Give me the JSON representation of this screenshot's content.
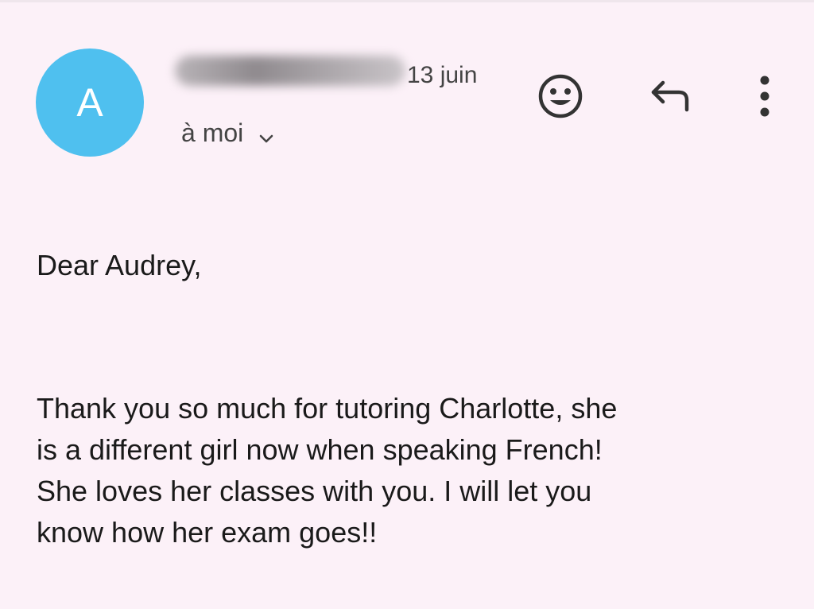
{
  "email": {
    "avatar_letter": "A",
    "date": "13 juin",
    "recipient": "à moi",
    "greeting": "Dear Audrey,",
    "body_lines": [
      "Thank you so much for tutoring Charlotte, she",
      "is a different girl now when speaking French!",
      "She loves her classes with you.  I will let you",
      "know how her exam goes!!"
    ]
  },
  "colors": {
    "avatar": "#4fc0ef",
    "background": "#fcf1f8"
  },
  "icons": {
    "emoji": "add-reaction-icon",
    "reply": "reply-icon",
    "more": "more-vertical-icon",
    "recipient_toggle": "chevron-down-icon"
  }
}
